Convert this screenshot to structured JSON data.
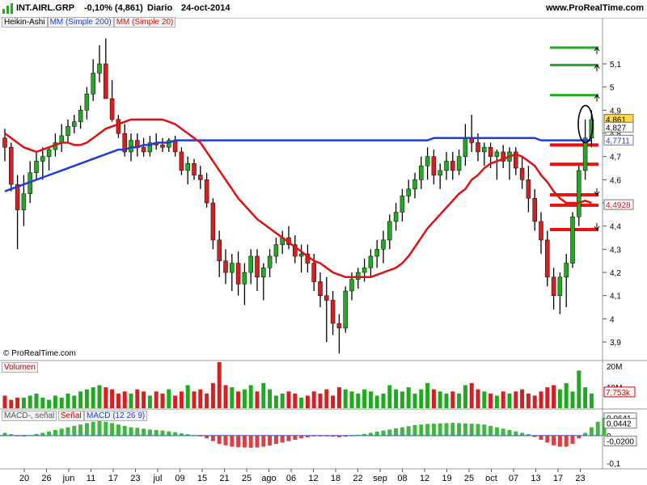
{
  "header": {
    "ticker": "INT.AIRL.GRP",
    "change": "-0,10% (4,861)",
    "period": "Diario",
    "date": "24-oct-2014",
    "site": "www.ProRealTime.com"
  },
  "legend": {
    "ha": "Heikin-Ashi",
    "mm200": "MM (Simple 200)",
    "mm20": "MM (Simple 20)"
  },
  "copyright": "© ProRealTime.com",
  "volume_label": "Volumen",
  "macd_labels": {
    "a": "MACD-, señal",
    "b": "Señal",
    "c": "MACD (12 26 9)"
  },
  "colors": {
    "up": "#1faa1f",
    "down": "#d81e1e",
    "mm200": "#1f3cd8",
    "mm20": "#dd1111",
    "levels_red": "#ee1111",
    "levels_green": "#22aa22"
  },
  "chart_data": [
    {
      "type": "candlestick",
      "title": "INT.AIRL.GRP",
      "ylim": [
        3.82,
        5.25
      ],
      "y_ticks": [
        "5,1",
        "5",
        "4,9",
        "4,8",
        "4,7",
        "4,6",
        "4,5",
        "4,4",
        "4,3",
        "4,2",
        "4,1",
        "4",
        "3,9"
      ],
      "x_ticks": [
        "20",
        "26",
        "jun",
        "11",
        "17",
        "23",
        "jul",
        "09",
        "15",
        "21",
        "25",
        "ago",
        "06",
        "12",
        "18",
        "22",
        "sep",
        "08",
        "12",
        "19",
        "25",
        "oct",
        "07",
        "13",
        "17",
        "23"
      ],
      "ha_candles": [
        [
          4.78,
          4.82,
          4.68,
          4.74
        ],
        [
          4.74,
          4.76,
          4.55,
          4.58
        ],
        [
          4.58,
          4.62,
          4.3,
          4.47
        ],
        [
          4.47,
          4.62,
          4.4,
          4.54
        ],
        [
          4.54,
          4.68,
          4.5,
          4.63
        ],
        [
          4.63,
          4.72,
          4.6,
          4.68
        ],
        [
          4.68,
          4.74,
          4.6,
          4.7
        ],
        [
          4.7,
          4.74,
          4.64,
          4.73
        ],
        [
          4.73,
          4.8,
          4.7,
          4.76
        ],
        [
          4.76,
          4.84,
          4.72,
          4.79
        ],
        [
          4.79,
          4.86,
          4.76,
          4.83
        ],
        [
          4.83,
          4.88,
          4.8,
          4.85
        ],
        [
          4.85,
          4.92,
          4.82,
          4.9
        ],
        [
          4.9,
          5.0,
          4.86,
          4.97
        ],
        [
          4.97,
          5.12,
          4.94,
          5.06
        ],
        [
          5.06,
          5.18,
          5.02,
          5.1
        ],
        [
          5.1,
          5.21,
          4.96,
          4.95
        ],
        [
          4.95,
          5.03,
          4.85,
          4.86
        ],
        [
          4.86,
          4.88,
          4.78,
          4.8
        ],
        [
          4.8,
          4.84,
          4.7,
          4.72
        ],
        [
          4.72,
          4.8,
          4.68,
          4.77
        ],
        [
          4.77,
          4.8,
          4.7,
          4.74
        ],
        [
          4.74,
          4.78,
          4.7,
          4.72
        ],
        [
          4.72,
          4.79,
          4.7,
          4.76
        ],
        [
          4.76,
          4.8,
          4.73,
          4.75
        ],
        [
          4.75,
          4.78,
          4.72,
          4.74
        ],
        [
          4.74,
          4.78,
          4.72,
          4.77
        ],
        [
          4.77,
          4.79,
          4.7,
          4.72
        ],
        [
          4.72,
          4.74,
          4.62,
          4.64
        ],
        [
          4.64,
          4.7,
          4.58,
          4.67
        ],
        [
          4.67,
          4.69,
          4.6,
          4.62
        ],
        [
          4.62,
          4.66,
          4.56,
          4.6
        ],
        [
          4.6,
          4.63,
          4.48,
          4.5
        ],
        [
          4.5,
          4.52,
          4.3,
          4.34
        ],
        [
          4.34,
          4.38,
          4.18,
          4.25
        ],
        [
          4.25,
          4.3,
          4.15,
          4.2
        ],
        [
          4.2,
          4.28,
          4.12,
          4.24
        ],
        [
          4.24,
          4.29,
          4.1,
          4.15
        ],
        [
          4.15,
          4.24,
          4.06,
          4.2
        ],
        [
          4.2,
          4.3,
          4.15,
          4.27
        ],
        [
          4.27,
          4.3,
          4.12,
          4.18
        ],
        [
          4.18,
          4.24,
          4.08,
          4.22
        ],
        [
          4.22,
          4.3,
          4.18,
          4.27
        ],
        [
          4.27,
          4.35,
          4.24,
          4.32
        ],
        [
          4.32,
          4.38,
          4.28,
          4.35
        ],
        [
          4.35,
          4.4,
          4.3,
          4.32
        ],
        [
          4.32,
          4.36,
          4.24,
          4.27
        ],
        [
          4.27,
          4.32,
          4.2,
          4.28
        ],
        [
          4.28,
          4.32,
          4.2,
          4.24
        ],
        [
          4.24,
          4.28,
          4.12,
          4.16
        ],
        [
          4.16,
          4.2,
          4.05,
          4.1
        ],
        [
          4.1,
          4.18,
          3.9,
          4.08
        ],
        [
          4.08,
          4.12,
          3.93,
          3.98
        ],
        [
          3.98,
          4.02,
          3.85,
          3.96
        ],
        [
          3.96,
          4.14,
          3.94,
          4.12
        ],
        [
          4.12,
          4.2,
          4.08,
          4.17
        ],
        [
          4.17,
          4.22,
          4.13,
          4.2
        ],
        [
          4.2,
          4.26,
          4.16,
          4.22
        ],
        [
          4.22,
          4.3,
          4.18,
          4.27
        ],
        [
          4.27,
          4.34,
          4.22,
          4.3
        ],
        [
          4.3,
          4.38,
          4.24,
          4.34
        ],
        [
          4.34,
          4.45,
          4.3,
          4.42
        ],
        [
          4.42,
          4.5,
          4.38,
          4.46
        ],
        [
          4.46,
          4.56,
          4.42,
          4.53
        ],
        [
          4.53,
          4.6,
          4.5,
          4.56
        ],
        [
          4.56,
          4.63,
          4.52,
          4.6
        ],
        [
          4.6,
          4.7,
          4.56,
          4.66
        ],
        [
          4.66,
          4.74,
          4.6,
          4.7
        ],
        [
          4.7,
          4.73,
          4.58,
          4.62
        ],
        [
          4.62,
          4.67,
          4.56,
          4.64
        ],
        [
          4.64,
          4.72,
          4.6,
          4.68
        ],
        [
          4.68,
          4.72,
          4.6,
          4.64
        ],
        [
          4.64,
          4.73,
          4.62,
          4.7
        ],
        [
          4.7,
          4.84,
          4.66,
          4.78
        ],
        [
          4.78,
          4.88,
          4.72,
          4.76
        ],
        [
          4.76,
          4.8,
          4.68,
          4.72
        ],
        [
          4.72,
          4.76,
          4.66,
          4.74
        ],
        [
          4.74,
          4.76,
          4.65,
          4.7
        ],
        [
          4.7,
          4.73,
          4.6,
          4.72
        ],
        [
          4.72,
          4.75,
          4.65,
          4.68
        ],
        [
          4.68,
          4.74,
          4.6,
          4.72
        ],
        [
          4.72,
          4.74,
          4.62,
          4.65
        ],
        [
          4.65,
          4.7,
          4.56,
          4.6
        ],
        [
          4.6,
          4.66,
          4.46,
          4.52
        ],
        [
          4.52,
          4.56,
          4.38,
          4.42
        ],
        [
          4.42,
          4.46,
          4.28,
          4.34
        ],
        [
          4.34,
          4.38,
          4.14,
          4.18
        ],
        [
          4.18,
          4.22,
          4.04,
          4.1
        ],
        [
          4.1,
          4.2,
          4.02,
          4.18
        ],
        [
          4.18,
          4.28,
          4.05,
          4.24
        ],
        [
          4.24,
          4.46,
          4.22,
          4.44
        ],
        [
          4.44,
          4.66,
          4.4,
          4.64
        ],
        [
          4.64,
          4.86,
          4.6,
          4.78
        ],
        [
          4.78,
          4.9,
          4.74,
          4.86
        ]
      ],
      "ma200": [
        4.55,
        4.56,
        4.57,
        4.58,
        4.59,
        4.6,
        4.61,
        4.62,
        4.63,
        4.64,
        4.65,
        4.66,
        4.67,
        4.68,
        4.69,
        4.7,
        4.71,
        4.72,
        4.73,
        4.73,
        4.74,
        4.74,
        4.75,
        4.75,
        4.76,
        4.76,
        4.76,
        4.77,
        4.77,
        4.77,
        4.77,
        4.77,
        4.77,
        4.77,
        4.77,
        4.77,
        4.77,
        4.77,
        4.77,
        4.77,
        4.77,
        4.77,
        4.77,
        4.77,
        4.77,
        4.77,
        4.77,
        4.77,
        4.77,
        4.77,
        4.77,
        4.77,
        4.77,
        4.77,
        4.77,
        4.77,
        4.77,
        4.77,
        4.77,
        4.77,
        4.77,
        4.77,
        4.77,
        4.77,
        4.77,
        4.77,
        4.77,
        4.77,
        4.78,
        4.78,
        4.78,
        4.78,
        4.78,
        4.78,
        4.78,
        4.78,
        4.78,
        4.78,
        4.78,
        4.78,
        4.78,
        4.78,
        4.78,
        4.78,
        4.78,
        4.77,
        4.77,
        4.77,
        4.77,
        4.77,
        4.77,
        4.77,
        4.77,
        4.77
      ],
      "ma20": [
        4.8,
        4.78,
        4.76,
        4.74,
        4.73,
        4.72,
        4.73,
        4.74,
        4.75,
        4.76,
        4.76,
        4.75,
        4.75,
        4.76,
        4.78,
        4.8,
        4.82,
        4.83,
        4.84,
        4.85,
        4.86,
        4.86,
        4.86,
        4.86,
        4.86,
        4.86,
        4.85,
        4.84,
        4.82,
        4.8,
        4.78,
        4.76,
        4.72,
        4.68,
        4.64,
        4.6,
        4.56,
        4.52,
        4.49,
        4.46,
        4.43,
        4.41,
        4.39,
        4.37,
        4.35,
        4.33,
        4.31,
        4.29,
        4.27,
        4.25,
        4.24,
        4.22,
        4.2,
        4.19,
        4.18,
        4.18,
        4.18,
        4.18,
        4.18,
        4.19,
        4.2,
        4.21,
        4.22,
        4.24,
        4.27,
        4.31,
        4.35,
        4.39,
        4.42,
        4.45,
        4.48,
        4.51,
        4.54,
        4.56,
        4.6,
        4.62,
        4.65,
        4.67,
        4.68,
        4.69,
        4.7,
        4.71,
        4.7,
        4.68,
        4.66,
        4.62,
        4.59,
        4.55,
        4.52,
        4.5,
        4.5,
        4.5,
        4.51,
        4.5
      ],
      "levels_red": [
        4.75,
        4.667,
        4.535,
        4.49,
        4.385
      ],
      "levels_green": [
        5.17,
        5.095,
        4.965
      ],
      "price_tags": [
        "4,861",
        "4,827",
        "4,7711",
        "4,4928"
      ]
    },
    {
      "type": "bar",
      "title": "Volumen",
      "ylim": [
        0,
        22
      ],
      "y_ticks": [
        "20M",
        "10M"
      ],
      "value_tag": "7,753k",
      "values": [
        6,
        4,
        5,
        5,
        6,
        7,
        5,
        4,
        6,
        5,
        7,
        6,
        8,
        9,
        10,
        11,
        10,
        9,
        7,
        8,
        7,
        9,
        8,
        6,
        8,
        7,
        9,
        6,
        8,
        11,
        8,
        9,
        7,
        12,
        22,
        11,
        10,
        8,
        9,
        11,
        8,
        12,
        9,
        6,
        7,
        8,
        7,
        5,
        6,
        8,
        7,
        9,
        6,
        10,
        9,
        8,
        7,
        9,
        8,
        6,
        7,
        11,
        9,
        8,
        10,
        7,
        9,
        12,
        9,
        8,
        7,
        8,
        7,
        11,
        12,
        9,
        8,
        7,
        6,
        8,
        7,
        8,
        9,
        7,
        6,
        8,
        10,
        11,
        9,
        12,
        8,
        18,
        10,
        7
      ]
    },
    {
      "type": "bar",
      "title": "MACD (12 26 9)",
      "ylim": [
        -0.12,
        0.09
      ],
      "y_ticks": [
        "0,0641",
        "0,0442",
        "0",
        "-0,0200",
        "-0,1"
      ],
      "values": [
        0.01,
        0.005,
        0.0,
        -0.002,
        0.002,
        0.006,
        0.01,
        0.015,
        0.02,
        0.025,
        0.03,
        0.035,
        0.04,
        0.045,
        0.05,
        0.055,
        0.05,
        0.045,
        0.04,
        0.035,
        0.03,
        0.028,
        0.025,
        0.022,
        0.02,
        0.018,
        0.015,
        0.012,
        0.008,
        0.005,
        0.002,
        -0.003,
        -0.01,
        -0.02,
        -0.03,
        -0.035,
        -0.04,
        -0.042,
        -0.043,
        -0.044,
        -0.043,
        -0.04,
        -0.036,
        -0.03,
        -0.025,
        -0.02,
        -0.015,
        -0.01,
        -0.006,
        -0.003,
        -0.002,
        -0.002,
        -0.004,
        -0.006,
        -0.004,
        0.0,
        0.003,
        0.006,
        0.01,
        0.014,
        0.018,
        0.022,
        0.026,
        0.03,
        0.034,
        0.038,
        0.04,
        0.042,
        0.043,
        0.044,
        0.045,
        0.046,
        0.045,
        0.044,
        0.043,
        0.042,
        0.04,
        0.035,
        0.03,
        0.025,
        0.02,
        0.015,
        0.01,
        0.005,
        -0.005,
        -0.015,
        -0.025,
        -0.035,
        -0.04,
        -0.04,
        -0.03,
        -0.01,
        0.01,
        0.03,
        0.05,
        0.064
      ]
    }
  ]
}
